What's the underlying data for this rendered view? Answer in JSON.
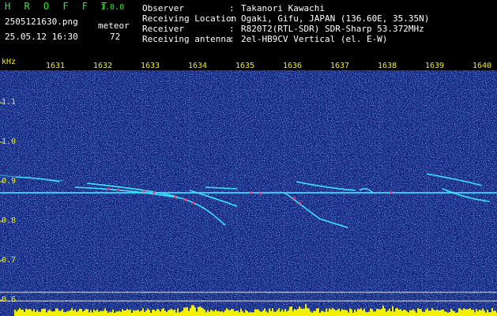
{
  "header": {
    "app_title": "H R O F F T",
    "app_version": "1.0.0",
    "file_name": "2505121630.png",
    "date_time": "25.05.12 16:30",
    "meteor_label": "meteor",
    "meteor_count": "72",
    "info": [
      {
        "label": "Observer",
        "sep": ":",
        "value": "Takanori Kawachi"
      },
      {
        "label": "Receiving Location",
        "sep": ":",
        "value": "Ogaki, Gifu, JAPAN (136.60E, 35.35N)"
      },
      {
        "label": "Receiver",
        "sep": ":",
        "value": "R820T2(RTL-SDR) SDR-Sharp 53.372MHz"
      },
      {
        "label": "Receiving antenna",
        "sep": ":",
        "value": "2el-HB9CV Vertical (el. E-W)"
      }
    ]
  },
  "spectrogram": {
    "y_unit": "kHz",
    "time_ticks": [
      "1631",
      "1632",
      "1633",
      "1634",
      "1635",
      "1636",
      "1637",
      "1638",
      "1639",
      "1640"
    ],
    "freq_ticks": [
      "1.1",
      "1.0",
      "0.9",
      "0.8",
      "0.7",
      "0.6"
    ],
    "colors": {
      "background": "#10207a",
      "noise": "#2f6bff",
      "trace": "#38e0ff",
      "hot": "#ff3a6a",
      "activity": "#f2f200"
    }
  }
}
